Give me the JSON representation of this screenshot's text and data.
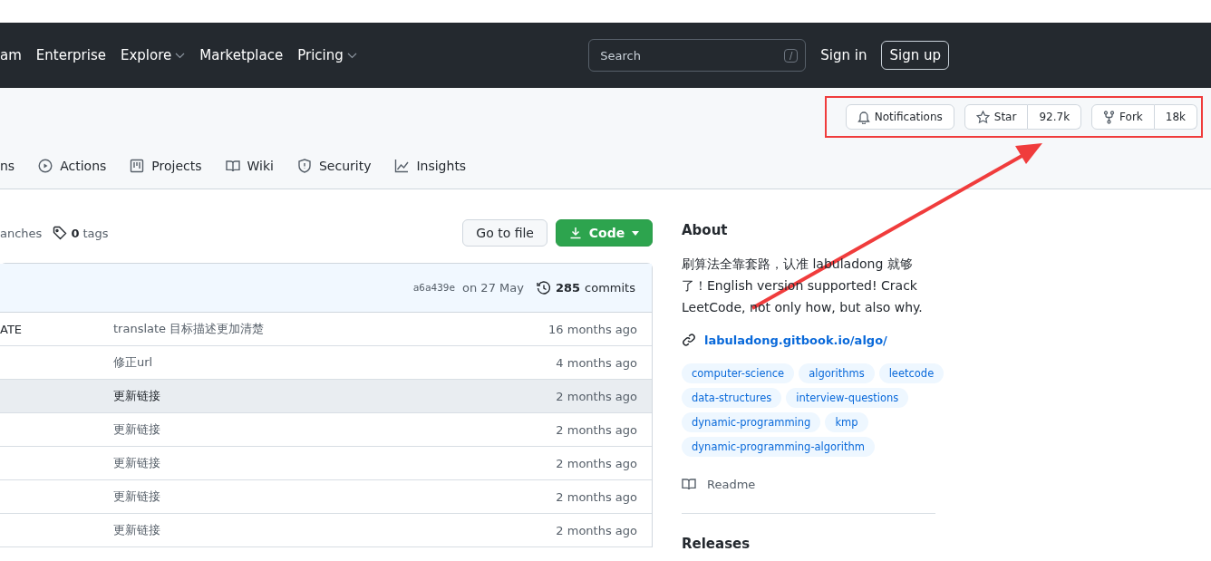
{
  "header": {
    "nav": [
      {
        "label": "am",
        "dropdown": false
      },
      {
        "label": "Enterprise",
        "dropdown": false
      },
      {
        "label": "Explore",
        "dropdown": true
      },
      {
        "label": "Marketplace",
        "dropdown": false
      },
      {
        "label": "Pricing",
        "dropdown": true
      }
    ],
    "search": {
      "placeholder": "Search",
      "shortcut": "/"
    },
    "sign_in": "Sign in",
    "sign_up": "Sign up"
  },
  "repo_actions": {
    "notifications": "Notifications",
    "star": "Star",
    "star_count": "92.7k",
    "fork": "Fork",
    "fork_count": "18k"
  },
  "tabs": [
    {
      "label": "ns"
    },
    {
      "label": "Actions"
    },
    {
      "label": "Projects"
    },
    {
      "label": "Wiki"
    },
    {
      "label": "Security"
    },
    {
      "label": "Insights"
    }
  ],
  "branch_bar": {
    "branches": "anches",
    "tags_count": "0",
    "tags_label": "tags",
    "go_to_file": "Go to file",
    "code": "Code"
  },
  "commit_bar": {
    "hash": "a6a439e",
    "date": "on 27 May",
    "commits_count": "285",
    "commits_label": "commits"
  },
  "files": [
    {
      "name": "ATE",
      "message": "translate 目标描述更加清楚",
      "age": "16 months ago",
      "highlighted": false
    },
    {
      "message": "修正url",
      "age": "4 months ago",
      "highlighted": false
    },
    {
      "message": "更新链接",
      "age": "2 months ago",
      "highlighted": true
    },
    {
      "message": "更新链接",
      "age": "2 months ago",
      "highlighted": false
    },
    {
      "message": "更新链接",
      "age": "2 months ago",
      "highlighted": false
    },
    {
      "message": "更新链接",
      "age": "2 months ago",
      "highlighted": false
    },
    {
      "message": "更新链接",
      "age": "2 months ago",
      "highlighted": false
    }
  ],
  "about": {
    "title": "About",
    "description": "刷算法全靠套路，认准 labuladong 就够了！English version supported! Crack LeetCode, not only how, but also why.",
    "link": "labuladong.gitbook.io/algo/",
    "topics": [
      "computer-science",
      "algorithms",
      "leetcode",
      "data-structures",
      "interview-questions",
      "dynamic-programming",
      "kmp",
      "dynamic-programming-algorithm"
    ],
    "readme": "Readme",
    "releases": "Releases"
  }
}
